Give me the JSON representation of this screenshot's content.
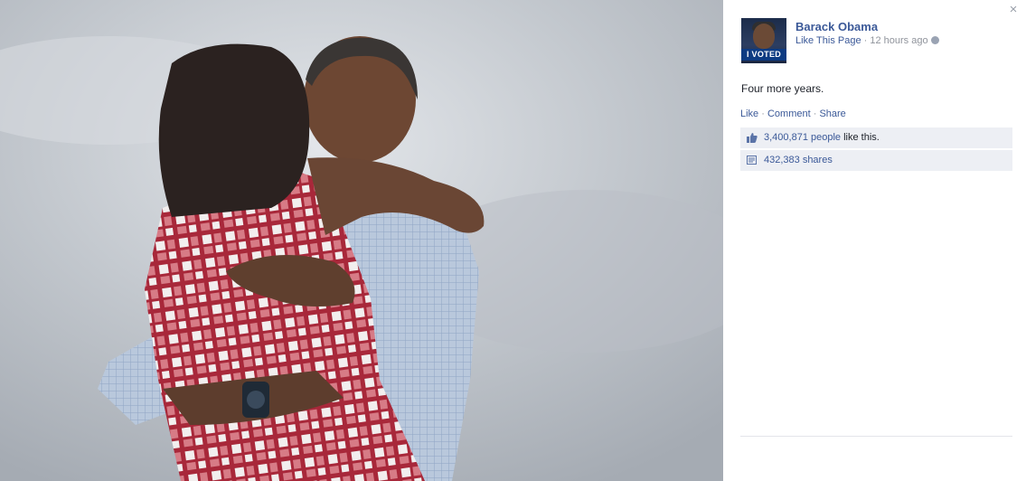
{
  "photo": {
    "description_icon": "photo-icon"
  },
  "panel": {
    "close_icon": "close-icon",
    "close_glyph": "×",
    "page_name": "Barack Obama",
    "profile_badge": "I VOTED",
    "like_page_label": "Like This Page",
    "separator": " · ",
    "timestamp": "12 hours ago",
    "privacy_icon": "globe-icon",
    "post_text": "Four more years.",
    "actions": {
      "like": "Like",
      "comment": "Comment",
      "share": "Share",
      "sep": " · "
    },
    "likes": {
      "icon": "thumbs-up-icon",
      "count": "3,400,871 people",
      "suffix": " like this."
    },
    "shares": {
      "icon": "share-icon",
      "label": "432,383 shares"
    }
  },
  "colors": {
    "link": "#3b5998",
    "meta": "#90949c",
    "stats_bg": "#edeff4",
    "viewer_bg": "#000000"
  }
}
